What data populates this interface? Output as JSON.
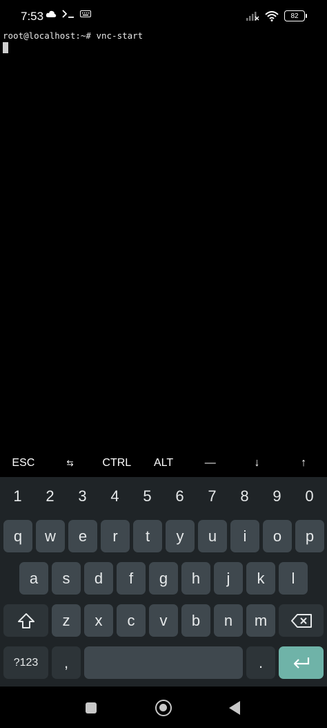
{
  "status_bar": {
    "time": "7:53",
    "battery": "82",
    "icons": [
      "cloud-icon",
      "terminal-icon",
      "keyboard-icon",
      "signal-icon",
      "wifi-icon",
      "battery-icon"
    ]
  },
  "terminal": {
    "prompt_line": "root@localhost:~# vnc-start"
  },
  "extra_keys": [
    "ESC",
    "⇆",
    "CTRL",
    "ALT",
    "—",
    "↓",
    "↑"
  ],
  "keyboard": {
    "numbers": [
      "1",
      "2",
      "3",
      "4",
      "5",
      "6",
      "7",
      "8",
      "9",
      "0"
    ],
    "row1": [
      "q",
      "w",
      "e",
      "r",
      "t",
      "y",
      "u",
      "i",
      "o",
      "p"
    ],
    "row2": [
      "a",
      "s",
      "d",
      "f",
      "g",
      "h",
      "j",
      "k",
      "l"
    ],
    "row3": [
      "z",
      "x",
      "c",
      "v",
      "b",
      "n",
      "m"
    ],
    "symbols_label": "?123",
    "comma": ",",
    "period": "."
  },
  "colors": {
    "keyboard_bg": "#1f2427",
    "key_bg": "#3f484e",
    "enter_bg": "#6fb3a8"
  }
}
